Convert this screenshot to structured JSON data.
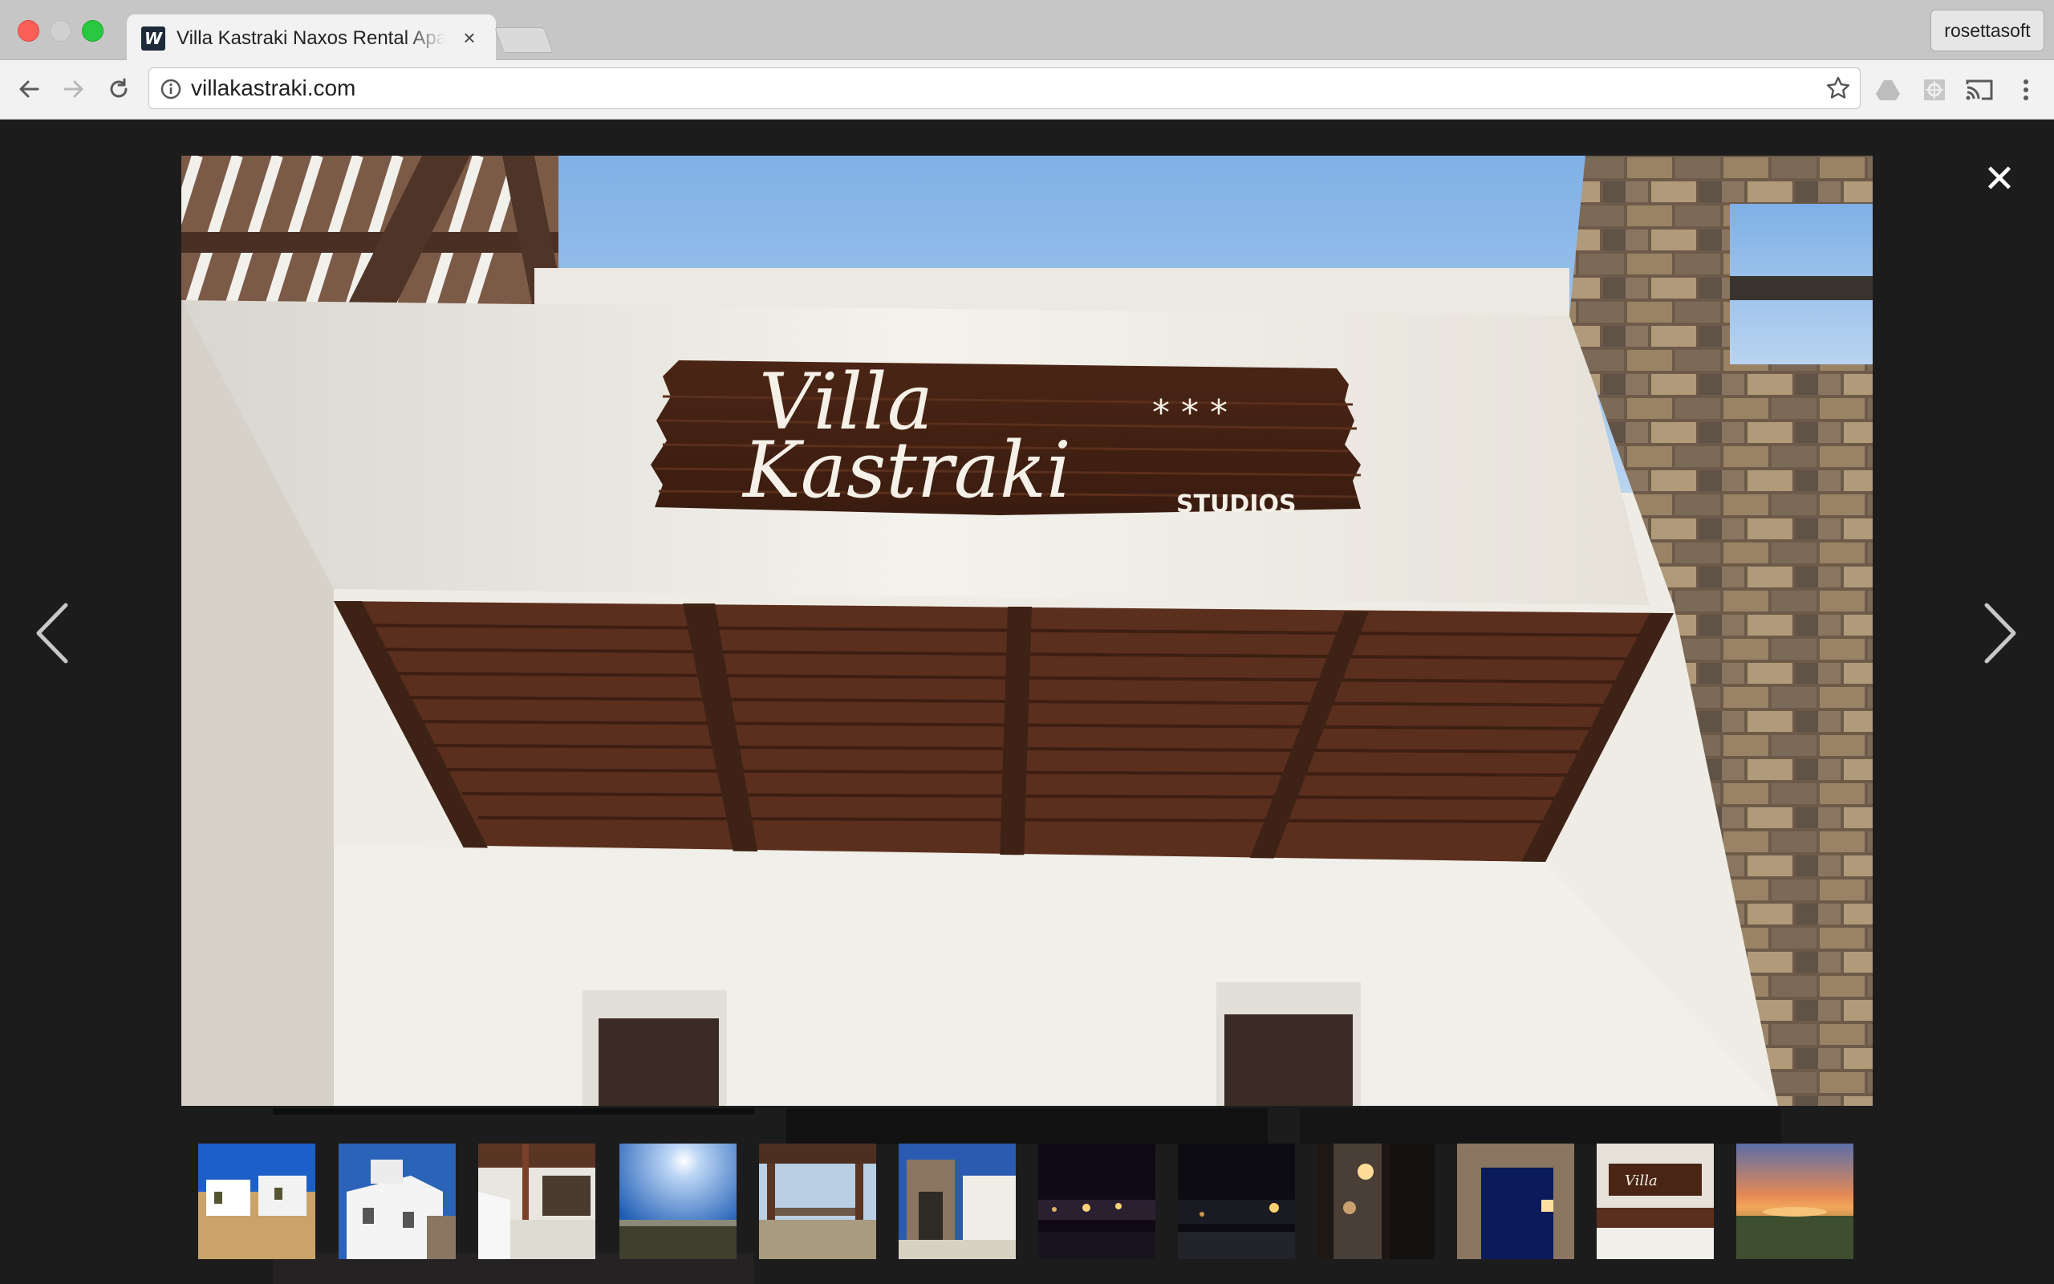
{
  "browser": {
    "tab": {
      "favicon_letter": "W",
      "title": "Villa Kastraki Naxos Rental Apartments",
      "close_glyph": "×"
    },
    "profile_name": "rosettasoft",
    "address": {
      "url": "villakastraki.com"
    },
    "icons": {
      "back": "back-arrow-icon",
      "forward": "forward-arrow-icon",
      "reload": "reload-icon",
      "info": "info-icon",
      "bookmark": "star-icon",
      "extensions": [
        "drive-icon",
        "extension-icon",
        "cast-icon",
        "menu-icon"
      ]
    }
  },
  "lightbox": {
    "close_glyph": "✕",
    "main_image": {
      "sign_line1": "Villa",
      "sign_line2": "Kastraki",
      "sign_small": "STUDIOS",
      "sign_stars": "* * *"
    },
    "thumbnail_count": 12,
    "thumbnails": [
      "two-buildings-field",
      "white-villa-blue-sky",
      "terrace-wooden-pergola",
      "sunny-sky-landscape",
      "pergola-view",
      "stone-arch-courtyard",
      "night-exterior-lights",
      "night-dark-exterior",
      "lit-stone-wall-night",
      "stone-doorway-night",
      "sign-close-up",
      "sunset-over-sea"
    ]
  },
  "colors": {
    "overlay": "#1d1c1d",
    "chrome": "#c6c6c6",
    "toolbar": "#f2f2f2"
  }
}
